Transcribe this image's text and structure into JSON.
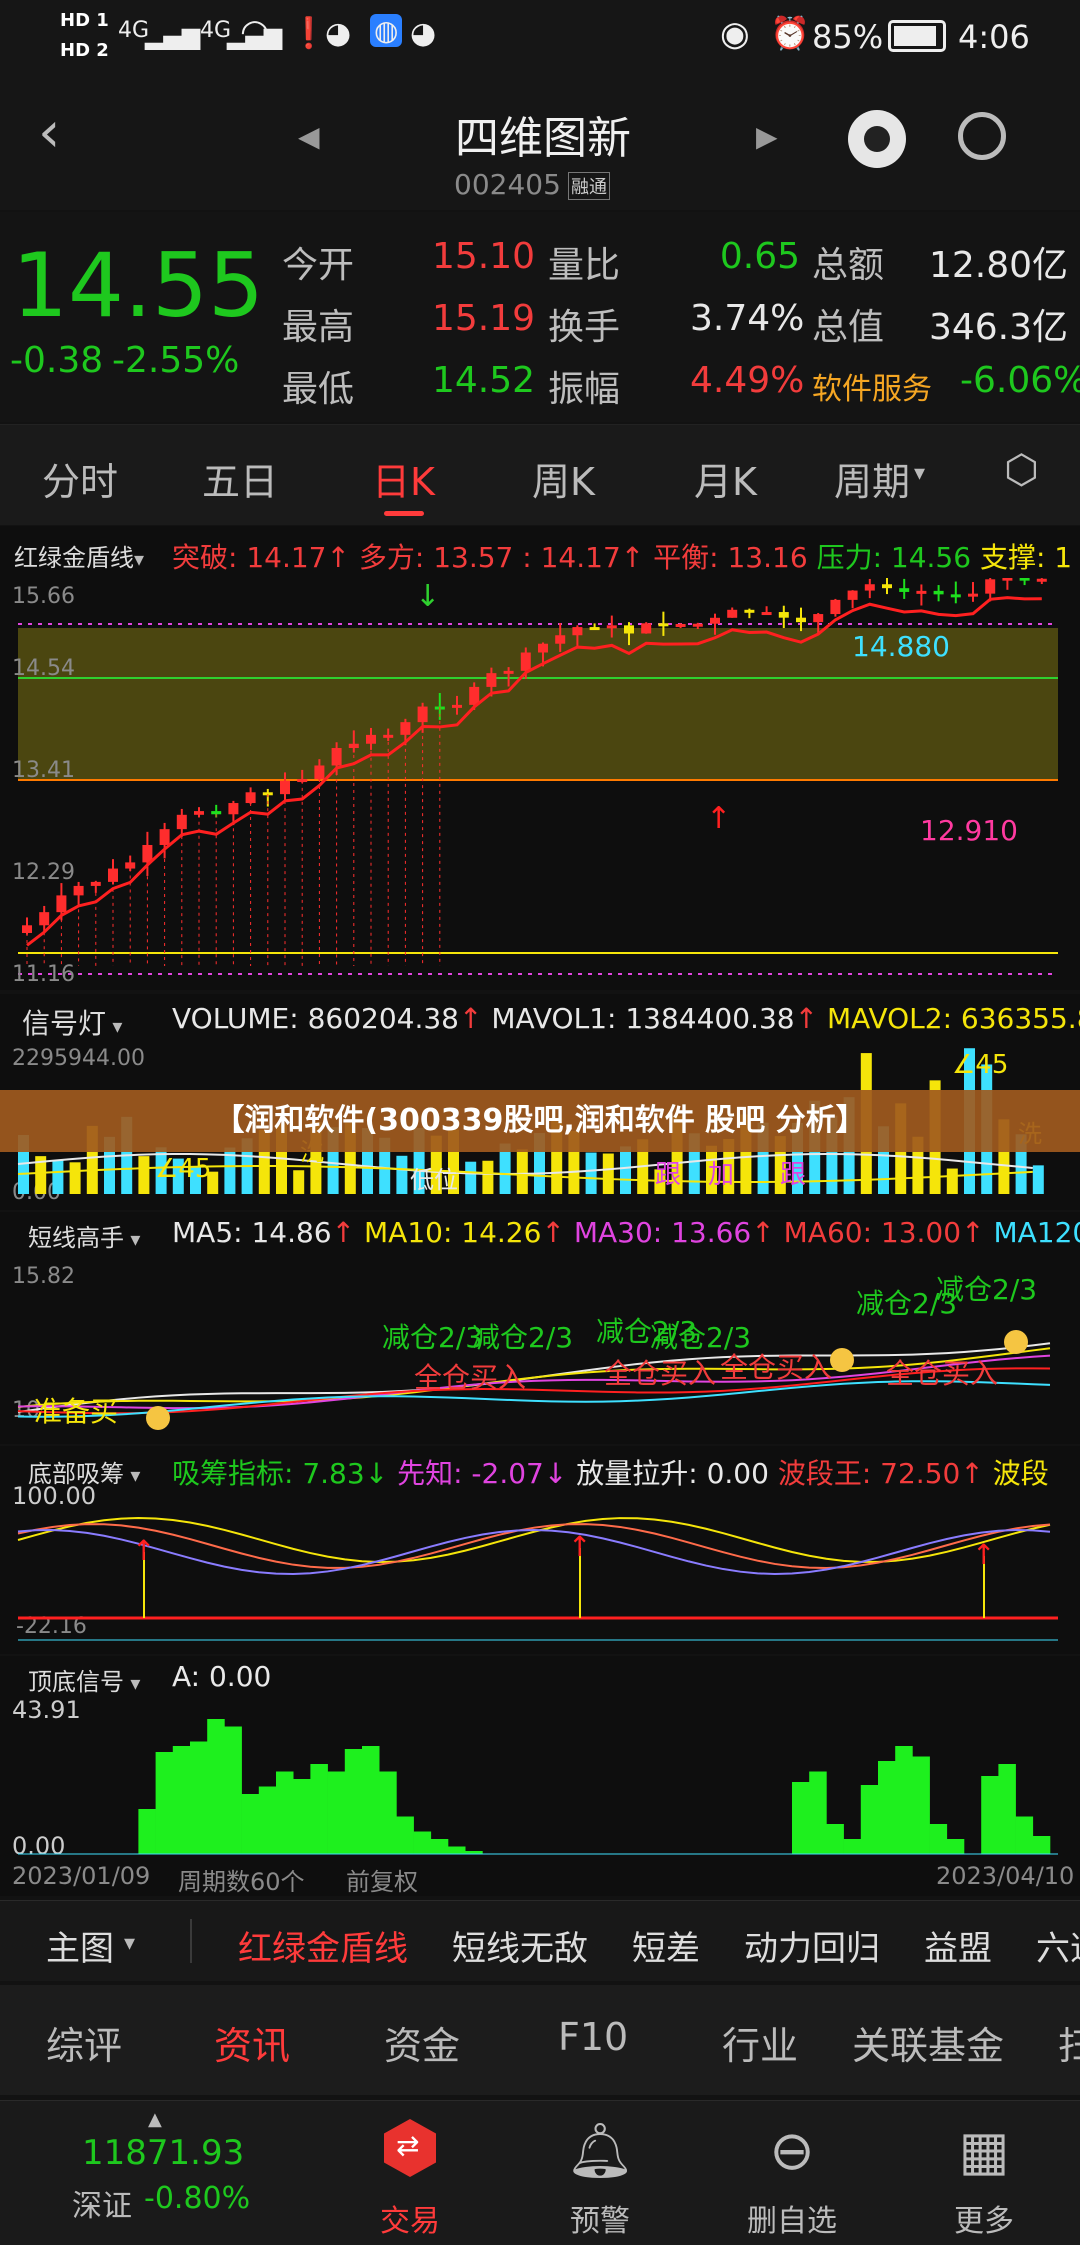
{
  "status": {
    "time": "4:06",
    "battery": "85%",
    "net1": "4G",
    "net2": "4G",
    "hd1": "HD 1",
    "hd2": "HD 2"
  },
  "header": {
    "title": "四维图新",
    "code": "002405",
    "badge": "融通"
  },
  "quote": {
    "price": "14.55",
    "change": "-0.38",
    "change_pct": "-2.55%",
    "rows": [
      {
        "l1": "今开",
        "v1": "15.10",
        "l2": "量比",
        "v2": "0.65",
        "l3": "总额",
        "v3": "12.80亿"
      },
      {
        "l1": "最高",
        "v1": "15.19",
        "l2": "换手",
        "v2": "3.74%",
        "l3": "总值",
        "v3": "346.3亿"
      },
      {
        "l1": "最低",
        "v1": "14.52",
        "l2": "振幅",
        "v2": "4.49%",
        "l3": "软件服务",
        "v3": "-6.06%"
      }
    ]
  },
  "period_tabs": [
    "分时",
    "五日",
    "日K",
    "周K",
    "月K",
    "周期"
  ],
  "main_chart": {
    "indicator": "红绿金盾线",
    "items": [
      {
        "t": "突破: 14.17",
        "c": "red"
      },
      {
        "t": "多方: 13.57",
        "c": "red"
      },
      {
        "t": ": 14.17",
        "c": "red"
      },
      {
        "t": "平衡: 13.16",
        "c": "red"
      },
      {
        "t": "压力: 14.56",
        "c": "green"
      },
      {
        "t": "支撑: 1",
        "c": "yellow"
      }
    ],
    "y_labels": [
      "15.66",
      "14.54",
      "13.41",
      "12.29",
      "11.16"
    ],
    "annot_high": "14.880",
    "annot_low": "12.910"
  },
  "vol_chart": {
    "indicator": "信号灯",
    "volume": "VOLUME: 860204.38",
    "mavol1": "MAVOL1: 1384400.38",
    "mavol2": "MAVOL2: 636355.8",
    "y_top": "2295944.00",
    "y_bottom": "0.00",
    "tags": [
      "∠45",
      "∠45",
      "跟",
      "加",
      "跟",
      "低位",
      "洗",
      "洗"
    ]
  },
  "banner": "【润和软件(300339股吧,润和软件 股吧 分析】",
  "ma_chart": {
    "indicator": "短线高手",
    "ma5": "MA5: 14.86",
    "ma10": "MA10: 14.26",
    "ma30": "MA30: 13.66",
    "ma60": "MA60: 13.00",
    "ma120": "MA120:",
    "y_top": "15.82",
    "y_bottom": "10",
    "signals": [
      "减仓2/3",
      "减仓2/3",
      "减仓2/3",
      "减仓2/3",
      "减仓2/3",
      "减仓2/3"
    ],
    "buys": [
      "全仓买入",
      "全仓买入",
      "全仓买入",
      "全仓买入"
    ],
    "prep": "准备买"
  },
  "bottom_chart": {
    "indicator": "底部吸筹",
    "xc": "吸筹指标: 7.83",
    "xz": "先知: -2.07",
    "fl": "放量拉升: 0.00",
    "bd": "波段王: 72.50",
    "bd2": "波段",
    "y_top": "100.00",
    "y_bottom": "-22.16"
  },
  "signal_chart": {
    "indicator": "顶底信号",
    "a": "A: 0.00",
    "y_top": "43.91",
    "y_bottom": "0.00",
    "heights": [
      0,
      0,
      0,
      0,
      0,
      0,
      0,
      0,
      0,
      0,
      0,
      0,
      0,
      0,
      0,
      30,
      68,
      72,
      75,
      90,
      85,
      40,
      45,
      55,
      50,
      60,
      55,
      70,
      72,
      55,
      25,
      15,
      10,
      5,
      2,
      0,
      0,
      0,
      0,
      0,
      0,
      0,
      0,
      0,
      0,
      0,
      0,
      0,
      0,
      0,
      0,
      0,
      0,
      0,
      0,
      0,
      0,
      0,
      0,
      0,
      0,
      0,
      0,
      0,
      0,
      0,
      0,
      0,
      0,
      0,
      0,
      0,
      0,
      0,
      0,
      0,
      0,
      0,
      0,
      0,
      0,
      0,
      0,
      0,
      0,
      0,
      0,
      0,
      0,
      0,
      0,
      0,
      0,
      0,
      0,
      0,
      0,
      0,
      0,
      0,
      0,
      0,
      0,
      0,
      0,
      0,
      0,
      0,
      0,
      0,
      0,
      0,
      0,
      0,
      0,
      0,
      0,
      0,
      0,
      0,
      0,
      0,
      0,
      0,
      0,
      0,
      0,
      0,
      0,
      0
    ]
  },
  "xaxis": {
    "start": "2023/01/09",
    "count": "周期数60个",
    "adjust": "前复权",
    "end": "2023/04/10"
  },
  "sub_tabs": [
    "主图",
    "红绿金盾线",
    "短线无敌",
    "短差",
    "动力回归",
    "益盟",
    "六道"
  ],
  "sec_tabs": [
    "综评",
    "资讯",
    "资金",
    "F10",
    "行业",
    "关联基金",
    "扫"
  ],
  "bottom_nav": {
    "index_value": "11871.93",
    "index_name": "深证",
    "index_change": "-0.80%",
    "trade": "交易",
    "alert": "预警",
    "remove": "删自选",
    "more": "更多"
  }
}
